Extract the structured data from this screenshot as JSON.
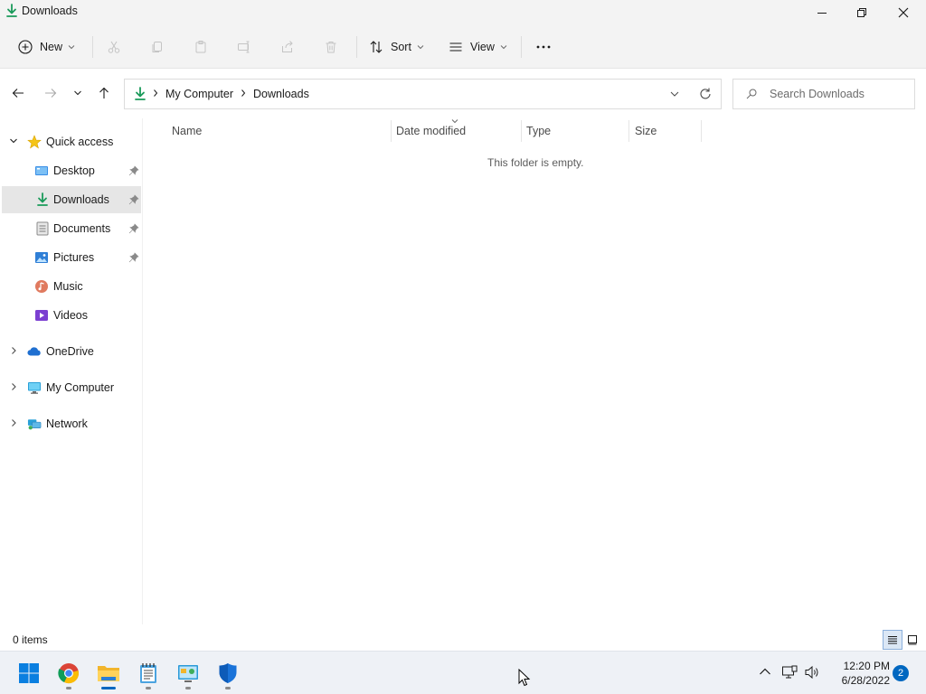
{
  "window": {
    "title": "Downloads"
  },
  "toolbar": {
    "new_label": "New",
    "sort_label": "Sort",
    "view_label": "View"
  },
  "address": {
    "crumbs": [
      "My Computer",
      "Downloads"
    ],
    "search_placeholder": "Search Downloads"
  },
  "sidebar": {
    "quick_access": "Quick access",
    "items": [
      {
        "label": "Desktop",
        "icon": "desktop-icon",
        "pinned": true
      },
      {
        "label": "Downloads",
        "icon": "download-icon",
        "pinned": true,
        "selected": true
      },
      {
        "label": "Documents",
        "icon": "documents-icon",
        "pinned": true
      },
      {
        "label": "Pictures",
        "icon": "pictures-icon",
        "pinned": true
      },
      {
        "label": "Music",
        "icon": "music-icon",
        "pinned": false
      },
      {
        "label": "Videos",
        "icon": "videos-icon",
        "pinned": false
      }
    ],
    "roots": [
      "OneDrive",
      "My Computer",
      "Network"
    ]
  },
  "columns": [
    "Name",
    "Date modified",
    "Type",
    "Size"
  ],
  "content": {
    "empty_message": "This folder is empty."
  },
  "status": {
    "item_count": "0 items"
  },
  "taskbar": {
    "apps": [
      "start-icon",
      "chrome-icon",
      "file-explorer-icon",
      "notepad-icon",
      "control-panel-icon",
      "security-shield-icon"
    ],
    "time": "12:20 PM",
    "date": "6/28/2022",
    "notification_count": "2"
  },
  "colors": {
    "accent": "#0067c0",
    "download_green": "#1a9a5a",
    "selected_bg": "#e6e6e6"
  }
}
